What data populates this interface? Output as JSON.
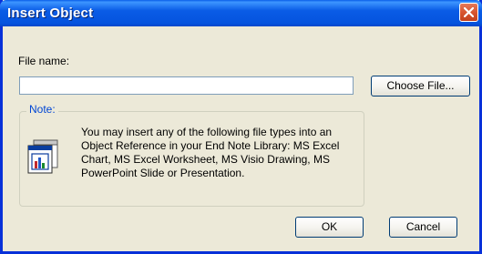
{
  "window": {
    "title": "Insert Object"
  },
  "file_name": {
    "label": "File name:",
    "value": "",
    "placeholder": ""
  },
  "buttons": {
    "choose_file": "Choose File...",
    "ok": "OK",
    "cancel": "Cancel"
  },
  "note": {
    "legend": "Note:",
    "text": "You may insert any of the following file types into an Object Reference in your End Note Library: MS Excel Chart, MS Excel Worksheet, MS Visio Drawing, MS PowerPoint Slide or Presentation."
  },
  "icons": {
    "close": "close-icon",
    "object": "object-document-icon"
  },
  "colors": {
    "title_bar": "#0a5ce6",
    "close_button": "#d8552f",
    "dialog_bg": "#ece9d8",
    "legend_text": "#0046d5"
  }
}
